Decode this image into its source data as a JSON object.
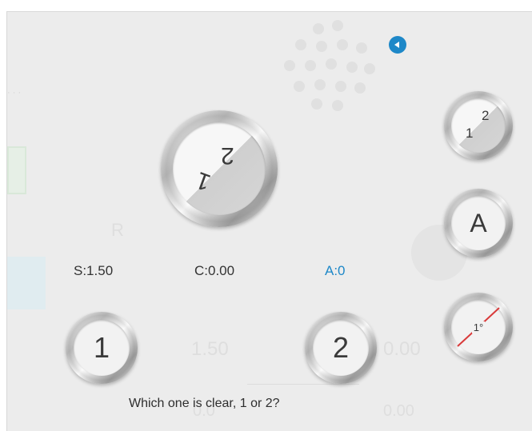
{
  "values": {
    "sphere": "S:1.50",
    "cylinder": "C:0.00",
    "axis": "A:0"
  },
  "buttons": {
    "lens_one": "1",
    "lens_two": "2",
    "toggle_small_one": "1",
    "toggle_small_two": "2",
    "toggle_large_one": "1",
    "toggle_large_two": "2",
    "axis_button": "A",
    "angle_button": "1°"
  },
  "prompt": "Which one is clear, 1 or 2?",
  "background": {
    "letter_r": "R",
    "value_left": "1.50",
    "value_right": "0.00",
    "value_bottom_left": "0.0",
    "value_bottom_right": "0.00"
  },
  "colors": {
    "accent": "#1e88c8",
    "angle_line": "#d93a3a",
    "text": "#333333",
    "panel": "#ececec"
  },
  "icons": {
    "back": "chevron-left-icon"
  }
}
